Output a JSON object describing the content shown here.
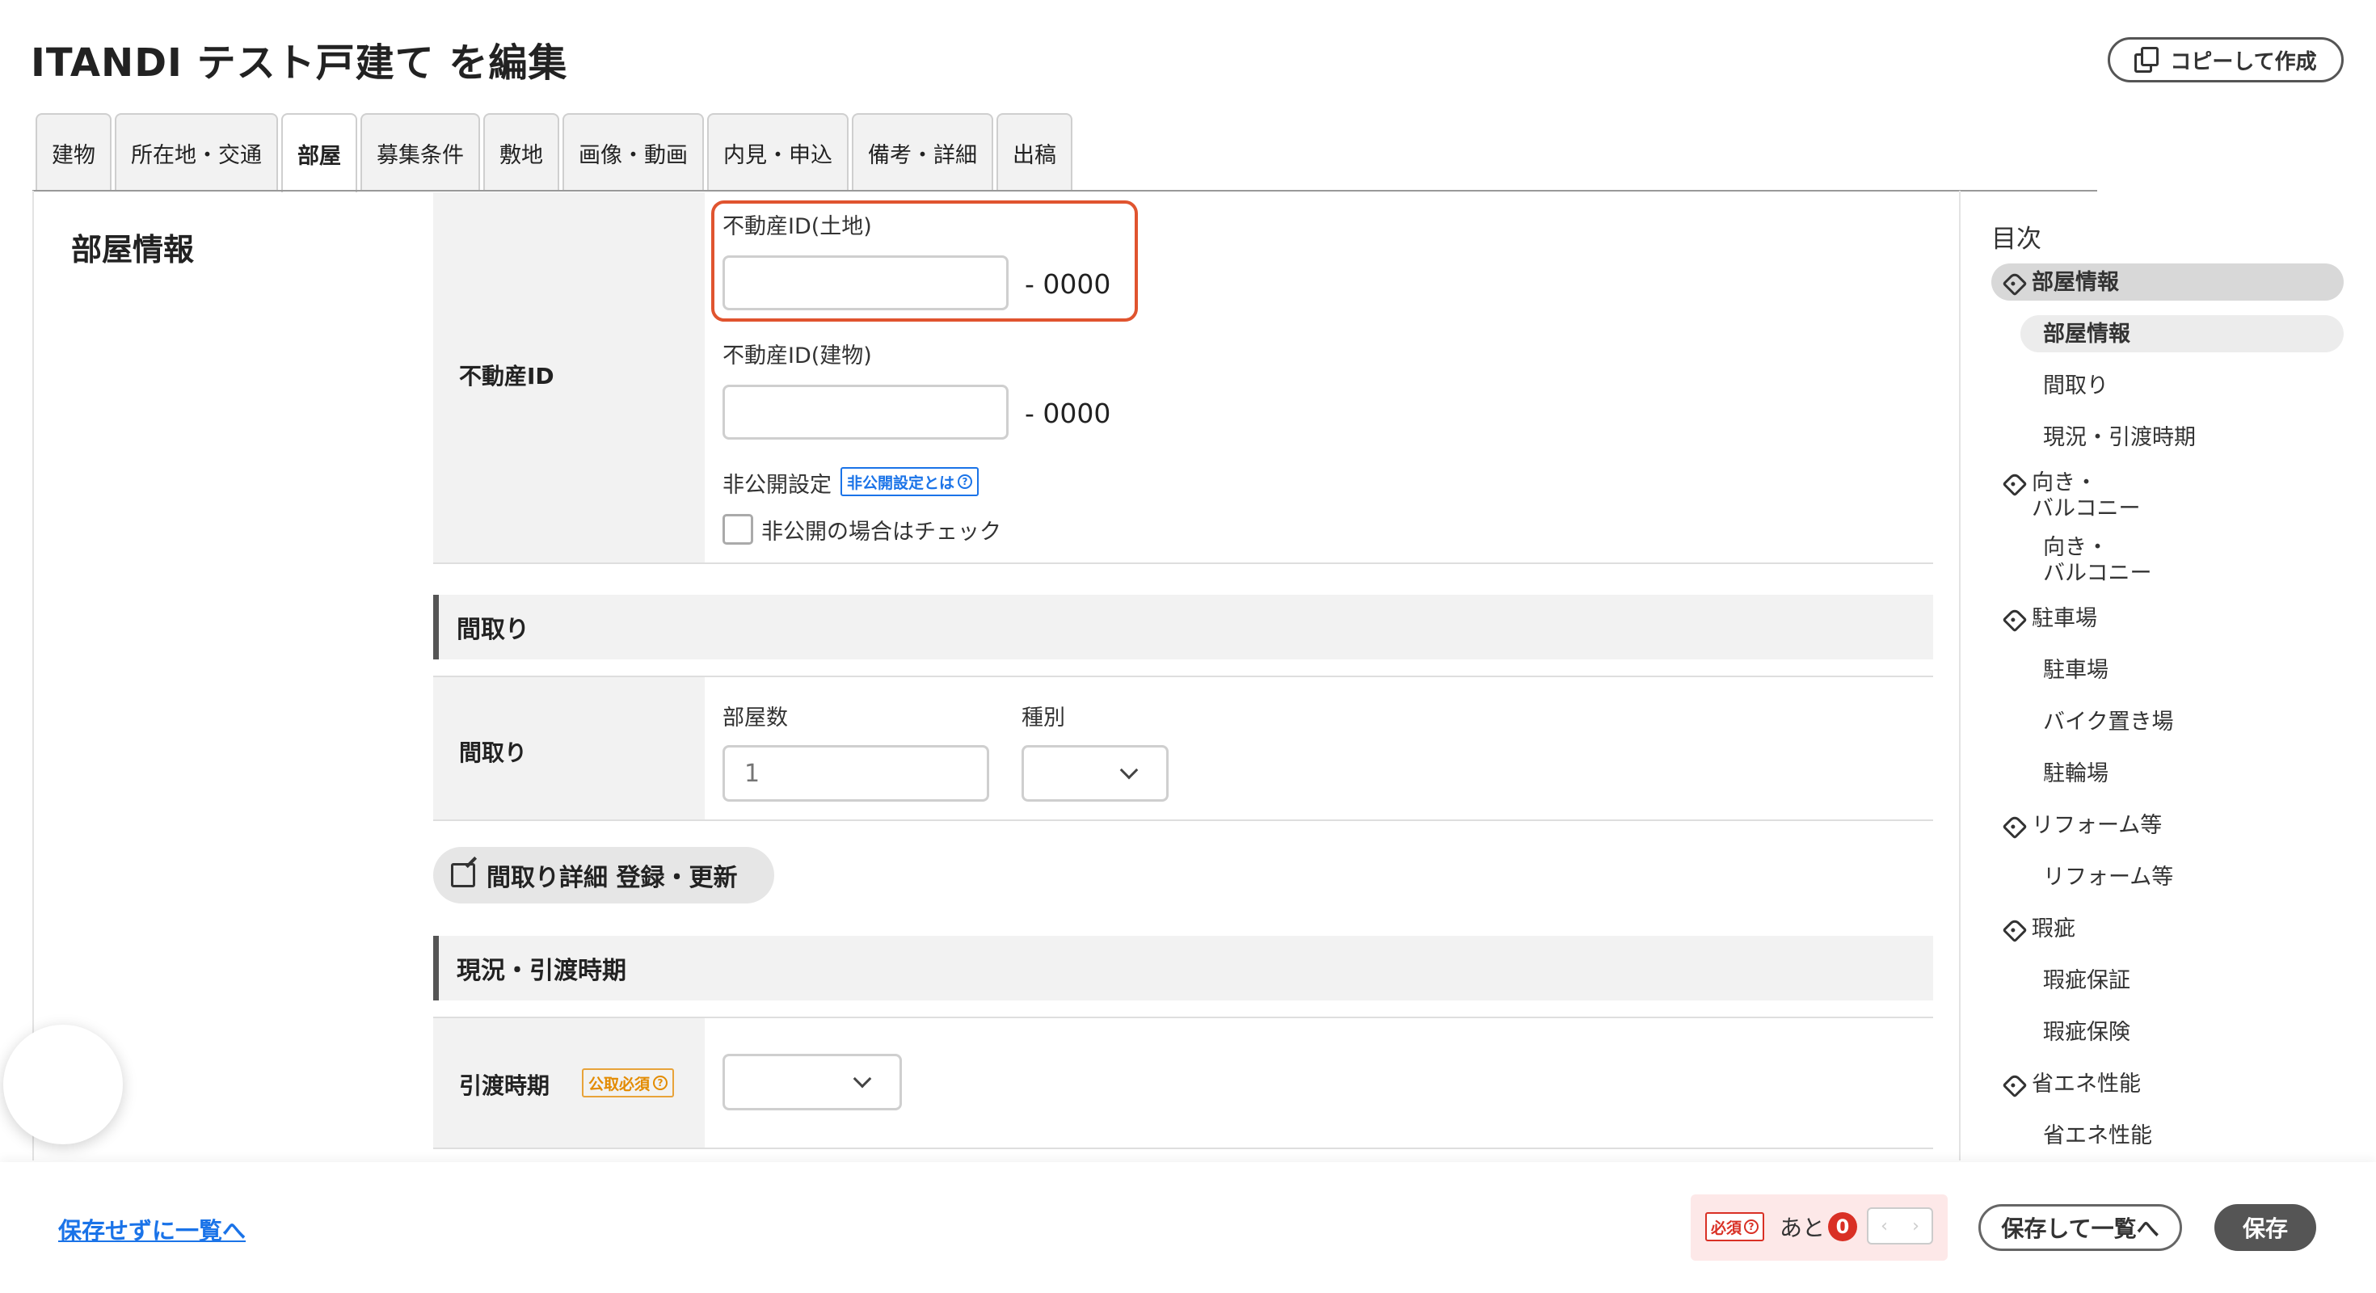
{
  "page_title": "ITANDI テスト戸建て を編集",
  "copy_button": "コピーして作成",
  "tabs": [
    {
      "label": "建物"
    },
    {
      "label": "所在地・交通"
    },
    {
      "label": "部屋"
    },
    {
      "label": "募集条件"
    },
    {
      "label": "敷地"
    },
    {
      "label": "画像・動画"
    },
    {
      "label": "内見・申込"
    },
    {
      "label": "備考・詳細"
    },
    {
      "label": "出稿"
    }
  ],
  "active_tab": "部屋",
  "section_title": "部屋情報",
  "property_id": {
    "row_label": "不動産ID",
    "land_label": "不動産ID(土地)",
    "land_value": "",
    "land_suffix": "-  0000",
    "building_label": "不動産ID(建物)",
    "building_value": "",
    "building_suffix": "-  0000",
    "private_label": "非公開設定",
    "private_help": "非公開設定とは",
    "private_check_label": "非公開の場合はチェック",
    "private_checked": false
  },
  "madori": {
    "section_title": "間取り",
    "row_label": "間取り",
    "rooms_label": "部屋数",
    "rooms_placeholder": "1",
    "type_label": "種別",
    "type_value": "",
    "detail_button": "間取り詳細 登録・更新"
  },
  "handover": {
    "section_title": "現況・引渡時期",
    "row_label": "引渡時期",
    "badge": "公取必須",
    "value": ""
  },
  "toc": {
    "title": "目次",
    "items": [
      {
        "label": "部屋情報",
        "category": true,
        "active": true
      },
      {
        "label": "部屋情報",
        "category": false,
        "active": true
      },
      {
        "label": "間取り",
        "category": false
      },
      {
        "label": "現況・引渡時期",
        "category": false
      },
      {
        "label": "向き・\nバルコニー",
        "category": true
      },
      {
        "label": "向き・\nバルコニー",
        "category": false
      },
      {
        "label": "駐車場",
        "category": true
      },
      {
        "label": "駐車場",
        "category": false
      },
      {
        "label": "バイク置き場",
        "category": false
      },
      {
        "label": "駐輪場",
        "category": false
      },
      {
        "label": "リフォーム等",
        "category": true
      },
      {
        "label": "リフォーム等",
        "category": false
      },
      {
        "label": "瑕疵",
        "category": true
      },
      {
        "label": "瑕疵保証",
        "category": false
      },
      {
        "label": "瑕疵保険",
        "category": false
      },
      {
        "label": "省エネ性能",
        "category": true
      },
      {
        "label": "省エネ性能",
        "category": false
      }
    ]
  },
  "footer": {
    "back_link": "保存せずに一覧へ",
    "required_badge": "必須",
    "remaining_label": "あと",
    "remaining_count": "0",
    "prev": "‹",
    "next": "›",
    "save_to_list": "保存して一覧へ",
    "save": "保存"
  },
  "colors": {
    "highlight": "#e0542f",
    "link": "#1a73e8",
    "required": "#d93025",
    "orange_badge": "#e38b00"
  }
}
